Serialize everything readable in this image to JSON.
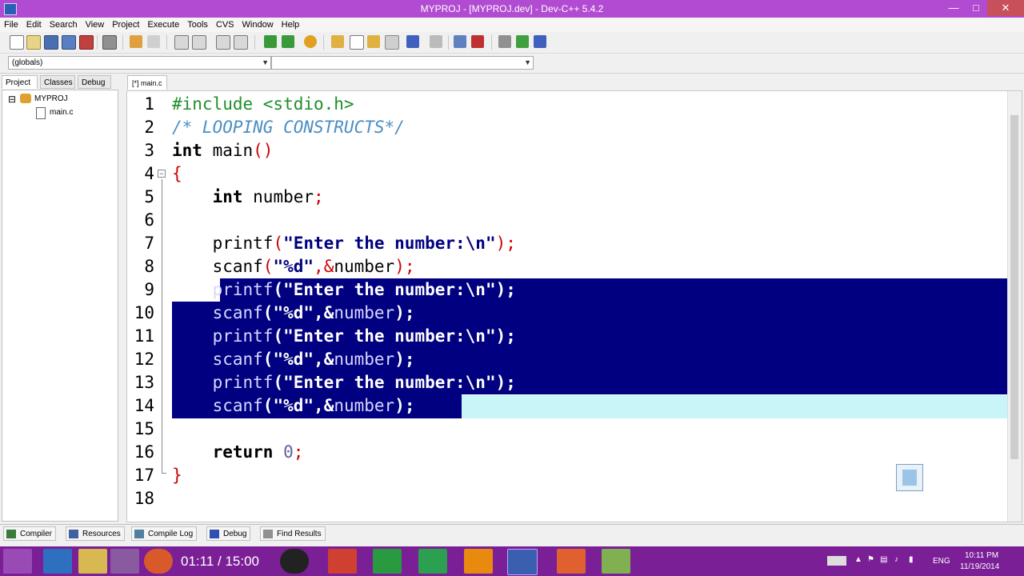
{
  "window": {
    "title": "MYPROJ - [MYPROJ.dev] - Dev-C++ 5.4.2",
    "minimize": "—",
    "maximize": "□",
    "close": "✕"
  },
  "menu": [
    "File",
    "Edit",
    "Search",
    "View",
    "Project",
    "Execute",
    "Tools",
    "CVS",
    "Window",
    "Help"
  ],
  "scope_combo": {
    "value": "(globals)"
  },
  "symbol_combo": {
    "value": ""
  },
  "left_panel": {
    "tabs": [
      "Project",
      "Classes",
      "Debug"
    ],
    "active_tab": "Project",
    "tree": {
      "project": "MYPROJ",
      "file": "main.c",
      "expander": "⊟"
    }
  },
  "editor": {
    "tab": "[*] main.c",
    "line_numbers": [
      "1",
      "2",
      "3",
      "4",
      "5",
      "6",
      "7",
      "8",
      "9",
      "10",
      "11",
      "12",
      "13",
      "14",
      "15",
      "16",
      "17",
      "18"
    ],
    "fold_marker": "−"
  },
  "code": {
    "l1": "#include <stdio.h>",
    "l2": "/* LOOPING CONSTRUCTS*/",
    "l3_kw": "int",
    "l3_id": " main",
    "l3_sym": "()",
    "l4": "{",
    "l5_indent": "    ",
    "l5_kw": "int",
    "l5_id": " number",
    "l5_sym": ";",
    "printf": "printf",
    "scanf": "scanf",
    "indent": "    ",
    "p_open": "(",
    "p_str": "\"Enter the number:\\n\"",
    "p_close": ");",
    "s_str": "\"%d\"",
    "s_comma": ",",
    "s_amp": "&",
    "s_var": "number",
    "l16_kw": "return",
    "l16_num": " 0",
    "l16_sym": ";",
    "l17": "}"
  },
  "bottom_tabs": [
    "Compiler",
    "Resources",
    "Compile Log",
    "Debug",
    "Find Results"
  ],
  "taskbar": {
    "video_time": "01:11 / 15:00",
    "lang": "ENG",
    "clock_time": "10:11 PM",
    "clock_date": "11/19/2014"
  },
  "colors": {
    "titlebar": "#b14bd1",
    "taskbar": "#7a1f96",
    "selection": "#000080",
    "current_line": "#c8f5f8",
    "preprocessor": "#1f8f2a",
    "comment": "#4b8ec2",
    "string": "#000080",
    "symbol": "#cc0000"
  }
}
